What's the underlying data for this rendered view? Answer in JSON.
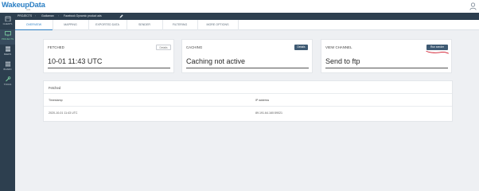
{
  "header": {
    "logo_text": "WakeupData",
    "logo_sub": "tools",
    "user_icon": "user-icon"
  },
  "sidebar": {
    "items": [
      {
        "label": "CLIENTS",
        "icon": "building-icon"
      },
      {
        "label": "PROJECTS",
        "icon": "monitor-icon"
      },
      {
        "label": "FEEDS",
        "icon": "stack-icon"
      },
      {
        "label": "BOARD",
        "icon": "grid-icon"
      },
      {
        "label": "TOOLS",
        "icon": "wrench-icon"
      }
    ]
  },
  "breadcrumb": {
    "items": [
      "PROJECTS",
      "Godiaman",
      "Facebook Dynamic product ads"
    ],
    "separator": "›"
  },
  "tabs": [
    "OVERVIEW",
    "MAPPING",
    "EXPORTED DATA",
    "SENDER",
    "FILTERING",
    "MORE OPTIONS"
  ],
  "cards": {
    "fetched": {
      "label": "FETCHED",
      "button": "Details",
      "value": "10-01 11:43 UTC"
    },
    "caching": {
      "label": "CACHING",
      "button": "Details",
      "value": "Caching not active"
    },
    "view_channel": {
      "label": "VIEW CHANNEL",
      "button": "Run sender",
      "value": "Send to ftp"
    }
  },
  "fetched_table": {
    "title": "Fetched",
    "columns": [
      "Timestamp",
      "IP address"
    ],
    "rows": [
      [
        "2020-10-01 11:43 UTC",
        "89.191.64.160:59021"
      ]
    ]
  },
  "colors": {
    "sidebar": "#2d3f4f",
    "accent": "#2b7fc4",
    "button_dark": "#3e5a73",
    "scribble": "#d0182a"
  }
}
